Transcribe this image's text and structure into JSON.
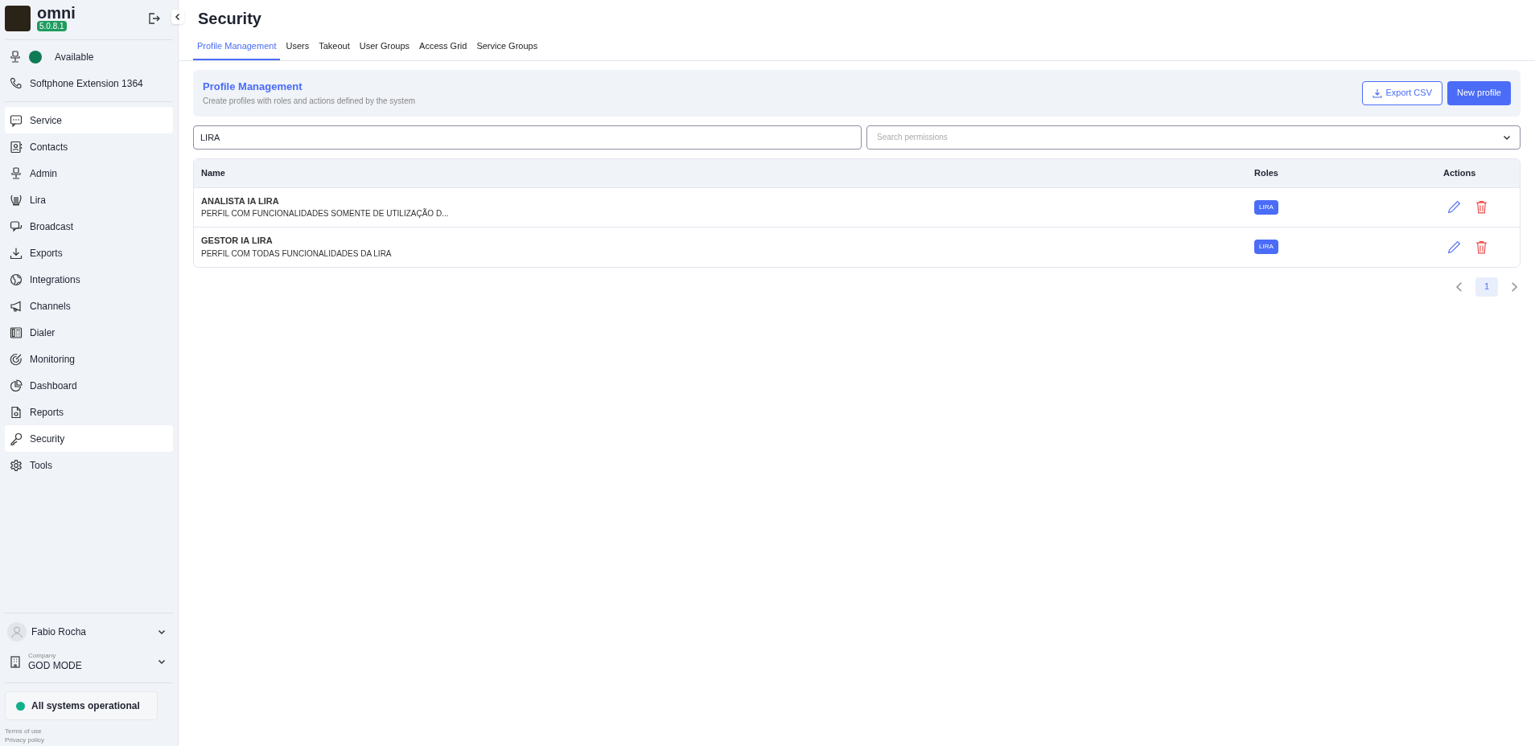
{
  "app": {
    "name": "omni",
    "version": "5.0.8.1"
  },
  "status": {
    "label": "Available",
    "color": "#0f7b55"
  },
  "softphone": "Softphone Extension 1364",
  "nav": [
    {
      "label": "Service",
      "selected": true
    },
    {
      "label": "Contacts",
      "selected": false
    },
    {
      "label": "Admin",
      "selected": false
    },
    {
      "label": "Lira",
      "selected": false
    },
    {
      "label": "Broadcast",
      "selected": false
    },
    {
      "label": "Exports",
      "selected": false
    },
    {
      "label": "Integrations",
      "selected": false
    },
    {
      "label": "Channels",
      "selected": false
    },
    {
      "label": "Dialer",
      "selected": false
    },
    {
      "label": "Monitoring",
      "selected": false
    },
    {
      "label": "Dashboard",
      "selected": false
    },
    {
      "label": "Reports",
      "selected": false
    },
    {
      "label": "Security",
      "selected": true
    },
    {
      "label": "Tools",
      "selected": false
    }
  ],
  "user": {
    "name": "Fabio Rocha"
  },
  "company": {
    "caption": "Company",
    "name": "GOD MODE"
  },
  "system_status": {
    "label": "All systems operational",
    "color": "#10b08a"
  },
  "footer_links": [
    "Terms of use",
    "Privacy policy"
  ],
  "page_title": "Security",
  "tabs": [
    {
      "label": "Profile Management",
      "selected": true
    },
    {
      "label": "Users",
      "selected": false
    },
    {
      "label": "Takeout",
      "selected": false
    },
    {
      "label": "User Groups",
      "selected": false
    },
    {
      "label": "Access Grid",
      "selected": false
    },
    {
      "label": "Service Groups",
      "selected": false
    }
  ],
  "panel": {
    "title": "Profile Management",
    "subtitle": "Create profiles with roles and actions defined by the system",
    "buttons": [
      {
        "label": "Export CSV",
        "kind": "outline"
      },
      {
        "label": "New profile",
        "kind": "primary"
      }
    ]
  },
  "search": {
    "value": "LIRA"
  },
  "permissions": {
    "placeholder": "Search permissions"
  },
  "table": {
    "columns": [
      "Name",
      "Roles",
      "Actions"
    ],
    "rows": [
      {
        "name": "ANALISTA IA LIRA",
        "description": "PERFIL COM FUNCIONALIDADES SOMENTE DE UTILIZAÇÃO D...",
        "roles": [
          "LIRA"
        ]
      },
      {
        "name": "GESTOR IA LIRA",
        "description": "PERFIL COM TODAS FUNCIONALIDADES DA LIRA",
        "roles": [
          "LIRA"
        ]
      }
    ]
  },
  "pagination": {
    "pages": [
      {
        "label": "1",
        "selected": true
      }
    ]
  }
}
